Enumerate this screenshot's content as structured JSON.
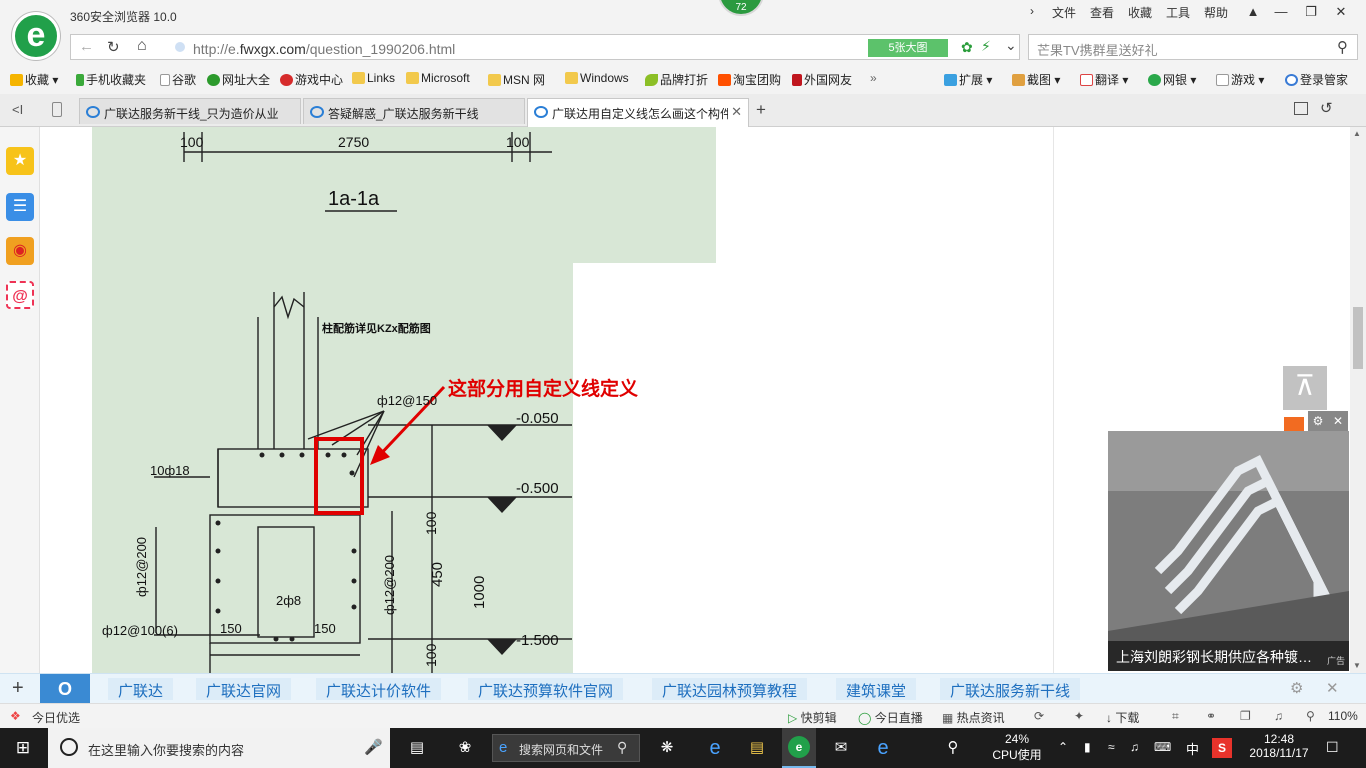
{
  "browser": {
    "title": "360安全浏览器 10.0",
    "score_badge": "72",
    "menu": [
      "文件",
      "查看",
      "收藏",
      "工具",
      "帮助"
    ],
    "window_buttons": [
      "shirt-icon",
      "minimize-icon",
      "restore-icon",
      "close-icon"
    ]
  },
  "address": {
    "url_prefix": "http://e.",
    "url_domain": "fwxgx.com",
    "url_path": "/question_1990206.html",
    "big_pic": "5张大图",
    "search_placeholder": "芒果TV携群星送好礼"
  },
  "bookmarks": {
    "items": [
      {
        "label": "收藏",
        "icon": "star-icon",
        "color": "#f5b400"
      },
      {
        "label": "手机收藏夹",
        "icon": "phone-icon",
        "color": "#3aa93a"
      },
      {
        "label": "谷歌",
        "icon": "page-icon",
        "color": "#bbbbbb"
      },
      {
        "label": "网址大全",
        "icon": "nav-icon",
        "color": "#2c9a2c"
      },
      {
        "label": "游戏中心",
        "icon": "game-icon",
        "color": "#d62b2b"
      },
      {
        "label": "Links",
        "icon": "folder-icon",
        "color": "#f2c94c"
      },
      {
        "label": "Microsoft",
        "icon": "folder-icon",
        "color": "#f2c94c"
      },
      {
        "label": "MSN 网",
        "icon": "folder-icon",
        "color": "#f2c94c"
      },
      {
        "label": "Windows",
        "icon": "folder-icon",
        "color": "#f2c94c"
      },
      {
        "label": "品牌打折",
        "icon": "leaf-icon",
        "color": "#8cbf26"
      },
      {
        "label": "淘宝团购",
        "icon": "taobao-icon",
        "color": "#ff5000"
      },
      {
        "label": "外国网友",
        "icon": "bookmark-icon",
        "color": "#c0161e"
      }
    ],
    "right_tools": [
      {
        "label": "扩展",
        "icon": "extension-icon"
      },
      {
        "label": "截图",
        "icon": "screenshot-icon"
      },
      {
        "label": "翻译",
        "icon": "translate-icon"
      },
      {
        "label": "网银",
        "icon": "bank-icon"
      },
      {
        "label": "游戏",
        "icon": "gamepad-icon"
      },
      {
        "label": "登录管家",
        "icon": "login-icon"
      }
    ]
  },
  "tabs": [
    {
      "label": "广联达服务新干线_只为造价从业",
      "active": false
    },
    {
      "label": "答疑解惑_广联达服务新干线",
      "active": false
    },
    {
      "label": "广联达用自定义线怎么画这个构件",
      "active": true
    }
  ],
  "drawing": {
    "top_dims": [
      "100",
      "2750",
      "100"
    ],
    "section_label": "1a-1a",
    "annotation": "这部分用自定义线定义",
    "column_note": "柱配筋详见KZx配筋图",
    "rebar_labels": [
      "ф12@150",
      "10ф18",
      "ф12@200",
      "ф12@200",
      "2ф8",
      "ф12@100(6)",
      "150",
      "150"
    ],
    "elevations": [
      "-0.050",
      "-0.500",
      "-1.500"
    ],
    "vertical_dims": [
      "450",
      "100",
      "1000",
      "100"
    ]
  },
  "ad": {
    "caption": "上海刘朗彩钢长期供应各种镀…",
    "tag": "广告"
  },
  "linkbar": {
    "links": [
      "广联达",
      "广联达官网",
      "广联达计价软件",
      "广联达预算软件官网",
      "广联达园林预算教程",
      "建筑课堂",
      "广联达服务新干线"
    ]
  },
  "statusbar": {
    "left": "今日优选",
    "items": [
      "快剪辑",
      "今日直播",
      "热点资讯",
      "下载"
    ],
    "zoom": "110%"
  },
  "taskbar": {
    "search_text": "在这里输入你要搜索的内容",
    "web_search": "搜索网页和文件",
    "cpu_percent": "24%",
    "cpu_label": "CPU使用",
    "ime": "中",
    "time": "12:48",
    "date": "2018/11/17"
  }
}
